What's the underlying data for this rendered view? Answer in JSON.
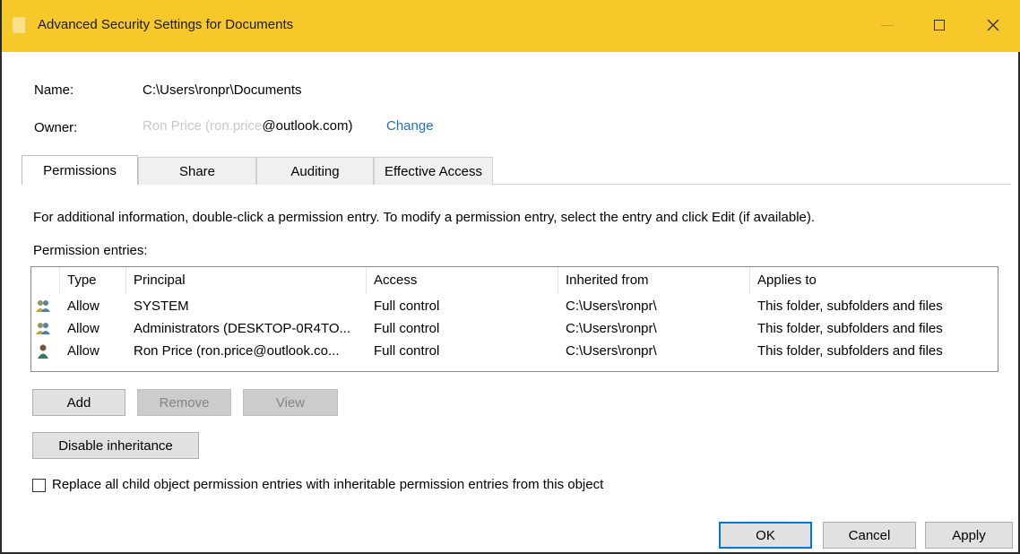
{
  "window": {
    "title": "Advanced Security Settings for Documents"
  },
  "details": {
    "name_label": "Name:",
    "name_value": "C:\\Users\\ronpr\\Documents",
    "owner_label": "Owner:",
    "owner_value_blurred": "Ron Price (ron.price",
    "owner_value_visible": "@outlook.com)",
    "change_link": "Change"
  },
  "tabs": [
    {
      "label": "Permissions",
      "active": true
    },
    {
      "label": "Share",
      "active": false
    },
    {
      "label": "Auditing",
      "active": false
    },
    {
      "label": "Effective Access",
      "active": false
    }
  ],
  "info_text": "For additional information, double-click a permission entry. To modify a permission entry, select the entry and click Edit (if available).",
  "entries_label": "Permission entries:",
  "table": {
    "columns": [
      "Type",
      "Principal",
      "Access",
      "Inherited from",
      "Applies to"
    ],
    "rows": [
      {
        "icon": "group-users-icon",
        "type": "Allow",
        "principal": "SYSTEM",
        "access": "Full control",
        "inherited": "C:\\Users\\ronpr\\",
        "applies": "This folder, subfolders and files"
      },
      {
        "icon": "group-users-icon",
        "type": "Allow",
        "principal": "Administrators (DESKTOP-0R4TO...",
        "access": "Full control",
        "inherited": "C:\\Users\\ronpr\\",
        "applies": "This folder, subfolders and files"
      },
      {
        "icon": "user-icon",
        "type": "Allow",
        "principal": "Ron Price (ron.price@outlook.co...",
        "access": "Full control",
        "inherited": "C:\\Users\\ronpr\\",
        "applies": "This folder, subfolders and files"
      }
    ]
  },
  "buttons": {
    "add": "Add",
    "remove": "Remove",
    "view": "View",
    "disable_inheritance": "Disable inheritance",
    "ok": "OK",
    "cancel": "Cancel",
    "apply": "Apply"
  },
  "replace_checkbox": {
    "label": "Replace all child object permission entries with inheritable permission entries from this object",
    "checked": false
  }
}
